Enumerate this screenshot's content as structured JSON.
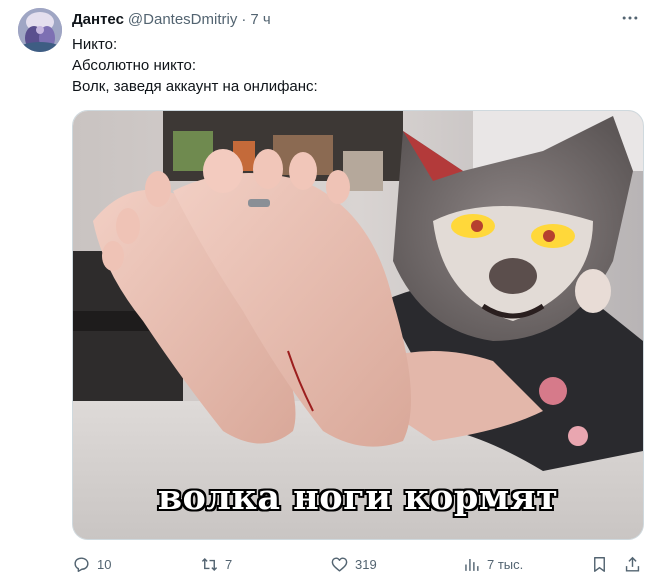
{
  "author": {
    "name": "Дантес",
    "handle": "@DantesDmitriy",
    "separator": "·",
    "time": "7 ч"
  },
  "tweet": {
    "lines": [
      "Никто:",
      "Абсолютно никто:",
      "Волк, заведя аккаунт на онлифанс:"
    ],
    "media_caption": "волка ноги кормят"
  },
  "actions": {
    "replies": "10",
    "retweets": "7",
    "likes": "319",
    "views": "7 тыс."
  },
  "icons": {
    "more": "more-dots-icon",
    "reply": "reply-icon",
    "retweet": "retweet-icon",
    "like": "heart-icon",
    "views": "views-chart-icon",
    "bookmark": "bookmark-icon",
    "share": "share-icon"
  },
  "colors": {
    "text_primary": "#0f1419",
    "text_secondary": "#536471",
    "border": "#cfd9de"
  }
}
